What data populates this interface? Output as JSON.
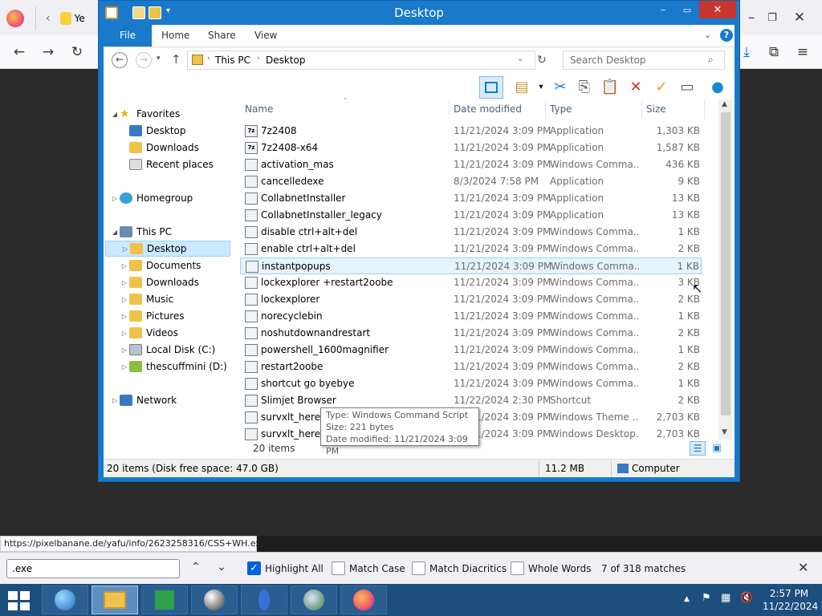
{
  "firefox": {
    "tab_label": "Ye",
    "url_status": "https://pixelbanane.de/yafu/info/2623258316/CSS+WH.exe",
    "find": {
      "query": ".exe",
      "highlight_all": "Highlight All",
      "match_case": "Match Case",
      "match_diacritics": "Match Diacritics",
      "whole_words": "Whole Words",
      "matches": "7 of 318 matches"
    }
  },
  "explorer": {
    "title": "Desktop",
    "ribbon_tabs": [
      "File",
      "Home",
      "Share",
      "View"
    ],
    "breadcrumb": [
      "This PC",
      "Desktop"
    ],
    "search_placeholder": "Search Desktop",
    "nav": {
      "favorites": "Favorites",
      "fav_items": [
        "Desktop",
        "Downloads",
        "Recent places"
      ],
      "homegroup": "Homegroup",
      "this_pc": "This PC",
      "pc_items": [
        "Desktop",
        "Documents",
        "Downloads",
        "Music",
        "Pictures",
        "Videos",
        "Local Disk (C:)",
        "thescuffmini (D:)"
      ],
      "network": "Network"
    },
    "columns": {
      "name": "Name",
      "date": "Date modified",
      "type": "Type",
      "size": "Size"
    },
    "files": [
      {
        "icon": "7z",
        "name": "7z2408",
        "date": "11/21/2024 3:09 PM",
        "type": "Application",
        "size": "1,303 KB"
      },
      {
        "icon": "7z",
        "name": "7z2408-x64",
        "date": "11/21/2024 3:09 PM",
        "type": "Application",
        "size": "1,587 KB"
      },
      {
        "icon": "",
        "name": "activation_mas",
        "date": "11/21/2024 3:09 PM",
        "type": "Windows Comma...",
        "size": "436 KB"
      },
      {
        "icon": "",
        "name": "cancelledexe",
        "date": "8/3/2024 7:58 PM",
        "type": "Application",
        "size": "9 KB"
      },
      {
        "icon": "",
        "name": "CollabnetInstaller",
        "date": "11/21/2024 3:09 PM",
        "type": "Application",
        "size": "13 KB"
      },
      {
        "icon": "",
        "name": "CollabnetInstaller_legacy",
        "date": "11/21/2024 3:09 PM",
        "type": "Application",
        "size": "13 KB"
      },
      {
        "icon": "",
        "name": "disable ctrl+alt+del",
        "date": "11/21/2024 3:09 PM",
        "type": "Windows Comma...",
        "size": "1 KB"
      },
      {
        "icon": "",
        "name": "enable ctrl+alt+del",
        "date": "11/21/2024 3:09 PM",
        "type": "Windows Comma...",
        "size": "2 KB"
      },
      {
        "icon": "",
        "name": "instantpopups",
        "date": "11/21/2024 3:09 PM",
        "type": "Windows Comma...",
        "size": "1 KB"
      },
      {
        "icon": "",
        "name": "lockexplorer +restart2oobe",
        "date": "11/21/2024 3:09 PM",
        "type": "Windows Comma...",
        "size": "3 KB"
      },
      {
        "icon": "",
        "name": "lockexplorer",
        "date": "11/21/2024 3:09 PM",
        "type": "Windows Comma...",
        "size": "2 KB"
      },
      {
        "icon": "",
        "name": "norecyclebin",
        "date": "11/21/2024 3:09 PM",
        "type": "Windows Comma...",
        "size": "1 KB"
      },
      {
        "icon": "",
        "name": "noshutdownandrestart",
        "date": "11/21/2024 3:09 PM",
        "type": "Windows Comma...",
        "size": "2 KB"
      },
      {
        "icon": "",
        "name": "powershell_1600magnifier",
        "date": "11/21/2024 3:09 PM",
        "type": "Windows Comma...",
        "size": "1 KB"
      },
      {
        "icon": "",
        "name": "restart2oobe",
        "date": "11/21/2024 3:09 PM",
        "type": "Windows Comma...",
        "size": "2 KB"
      },
      {
        "icon": "",
        "name": "shortcut go byebye",
        "date": "11/21/2024 3:09 PM",
        "type": "Windows Comma...",
        "size": "1 KB"
      },
      {
        "icon": "",
        "name": "Slimjet Browser",
        "date": "11/22/2024 2:30 PM",
        "type": "Shortcut",
        "size": "2 KB"
      },
      {
        "icon": "",
        "name": "survxlt_here_w",
        "date": "11/21/2024 3:09 PM",
        "type": "Windows Theme ...",
        "size": "2,703 KB"
      },
      {
        "icon": "",
        "name": "survxlt_here_w",
        "date": "11/21/2024 3:09 PM",
        "type": "Windows Desktop...",
        "size": "2,703 KB"
      }
    ],
    "selected_row": 8,
    "item_count": "20 items",
    "status": {
      "left": "20 items (Disk free space: 47.0 GB)",
      "size": "11.2 MB",
      "location": "Computer"
    },
    "tooltip": {
      "type": "Type: Windows Command Script",
      "size": "Size: 221 bytes",
      "date": "Date modified: 11/21/2024 3:09 PM"
    }
  },
  "taskbar": {
    "time": "2:57 PM",
    "date": "11/22/2024"
  },
  "colors": {
    "accent": "#1979ca",
    "taskbar": "#1c4e7e",
    "selection": "#cce8ff"
  }
}
